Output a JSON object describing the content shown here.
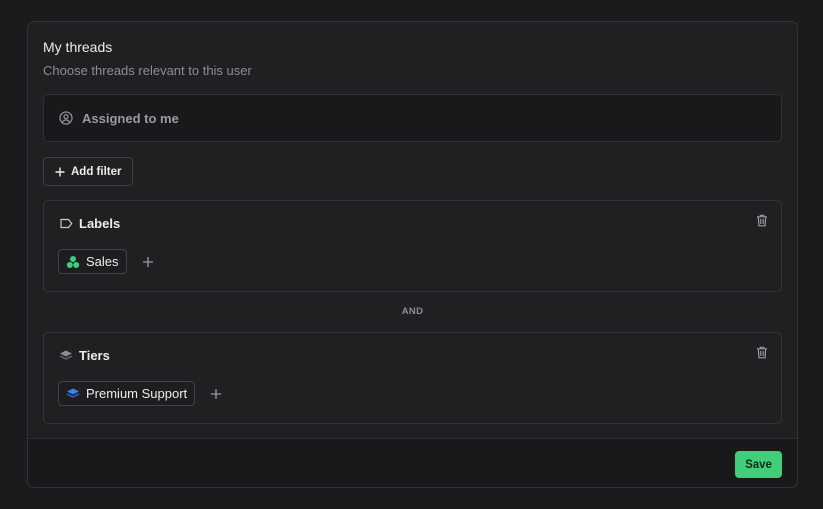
{
  "panel": {
    "title": "My threads",
    "subtitle": "Choose threads relevant to this user"
  },
  "assigned": {
    "icon": "user-circle-icon",
    "label": "Assigned to me"
  },
  "add_filter": {
    "icon": "plus-icon",
    "label": "Add filter"
  },
  "filters": [
    {
      "title": "Labels",
      "icon": "tag-icon",
      "chips": [
        {
          "label": "Sales",
          "icon": "label-dots-icon",
          "color": "#3fcf7a"
        }
      ]
    },
    {
      "title": "Tiers",
      "icon": "layers-icon",
      "chips": [
        {
          "label": "Premium Support",
          "icon": "layers-icon",
          "color": "#3b82f6"
        }
      ]
    }
  ],
  "separator": "AND",
  "footer": {
    "save_label": "Save"
  },
  "colors": {
    "accent": "#3fcf7a",
    "tier_blue": "#3b82f6"
  }
}
